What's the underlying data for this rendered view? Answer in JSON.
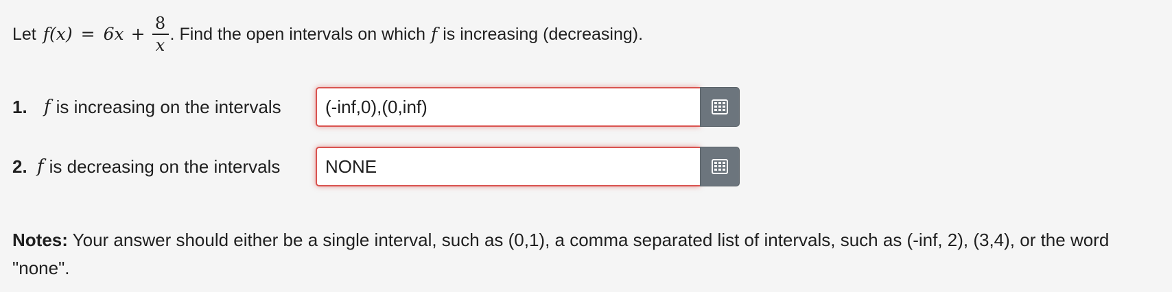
{
  "problem": {
    "statement": {
      "let_text": "Let",
      "function_lhs": "f(x)",
      "equals": "=",
      "term1": "6x",
      "plus": "+",
      "fraction_numerator": "8",
      "fraction_denominator": "x",
      "rest_text": ". Find the open intervals on which",
      "f_symbol": "f",
      "tail_text": "is increasing (decreasing)."
    },
    "questions": [
      {
        "number": "1.",
        "f_symbol": "f",
        "label": "is increasing on the intervals",
        "value": "(-inf,0),(0,inf)",
        "button_icon": "keypad-icon"
      },
      {
        "number": "2.",
        "f_symbol": "f",
        "label": "is decreasing on the intervals",
        "value": "NONE",
        "button_icon": "keypad-icon"
      }
    ],
    "notes": {
      "bold": "Notes:",
      "text": " Your answer should either be a single interval, such as (0,1), a comma separated list of intervals, such as (-inf, 2), (3,4), or the word \"none\"."
    }
  },
  "colors": {
    "page_background": "#f5f5f5",
    "error_border": "#d9534f",
    "button_background": "#6c757d"
  }
}
